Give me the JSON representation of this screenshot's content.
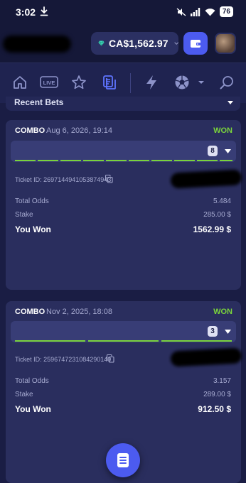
{
  "status_bar": {
    "time": "3:02",
    "battery": "76"
  },
  "header": {
    "balance": "CA$1,562.97",
    "icons": {
      "balance": "gem-icon",
      "wallet": "wallet-icon",
      "avatar": "avatar"
    }
  },
  "nav": {
    "items": [
      {
        "name": "home-icon"
      },
      {
        "name": "live-icon",
        "label": "LIVE"
      },
      {
        "name": "star-icon"
      },
      {
        "name": "my-bets-icon",
        "active": true
      },
      {
        "name": "lightning-icon"
      },
      {
        "name": "soccer-ball-icon"
      },
      {
        "name": "search-icon"
      }
    ]
  },
  "section": {
    "title": "Recent Bets"
  },
  "bets": [
    {
      "type": "COMBO",
      "date": "Aug 6, 2026, 19:14",
      "status": "WON",
      "legs_count": "8",
      "ticket_label": "Ticket ID: 2697144941053874943",
      "rows": [
        {
          "label": "Total Odds",
          "value": "5.484"
        },
        {
          "label": "Stake",
          "value": "285.00 $"
        }
      ],
      "won_label": "You Won",
      "won_value": "1562.99 $"
    },
    {
      "type": "COMBO",
      "date": "Nov 2, 2025, 18:08",
      "status": "WON",
      "legs_count": "3",
      "ticket_label": "Ticket ID: 2596747231084290149",
      "rows": [
        {
          "label": "Total Odds",
          "value": "3.157"
        },
        {
          "label": "Stake",
          "value": "289.00 $"
        }
      ],
      "won_label": "You Won",
      "won_value": "912.50 $"
    }
  ],
  "colors": {
    "background": "#1a1d44",
    "card": "#2a2e5e",
    "accent": "#4c5bf0",
    "won": "#7ad33c"
  }
}
